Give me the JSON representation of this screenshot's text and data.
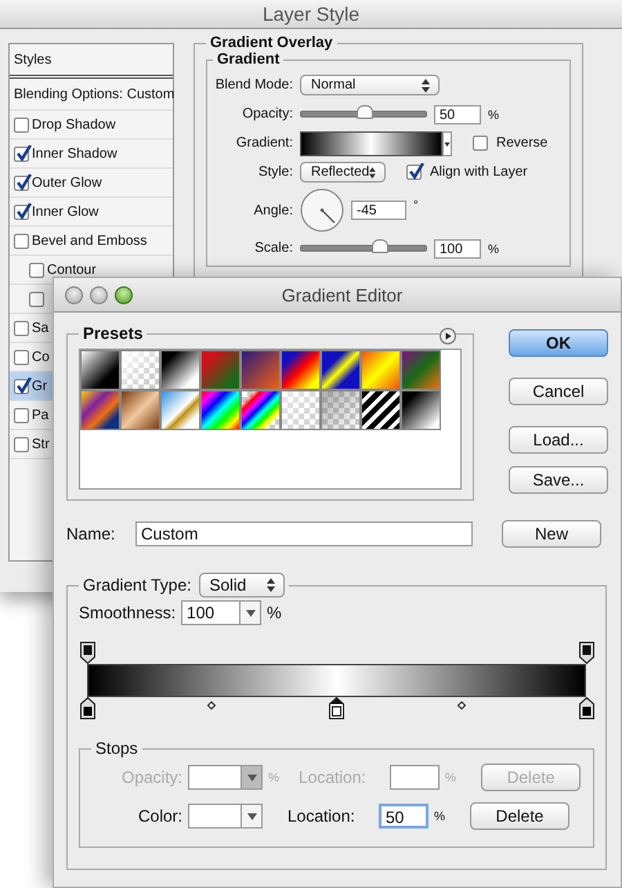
{
  "layer_style": {
    "title": "Layer Style",
    "styles_list": [
      {
        "label": "Styles",
        "kind": "header",
        "selected": false
      },
      {
        "label": "Blending Options: Custom",
        "kind": "header",
        "selected": false
      },
      {
        "label": "Drop Shadow",
        "kind": "check",
        "checked": false,
        "selected": false
      },
      {
        "label": "Inner Shadow",
        "kind": "check",
        "checked": true,
        "selected": false
      },
      {
        "label": "Outer Glow",
        "kind": "check",
        "checked": true,
        "selected": false
      },
      {
        "label": "Inner Glow",
        "kind": "check",
        "checked": true,
        "selected": false
      },
      {
        "label": "Bevel and Emboss",
        "kind": "check",
        "checked": false,
        "selected": false
      },
      {
        "label": "Contour",
        "kind": "subcheck",
        "checked": false,
        "selected": false
      },
      {
        "kind": "subcheck",
        "checked": false,
        "selected": false
      },
      {
        "label": "Sa",
        "kind": "check",
        "checked": false,
        "selected": false
      },
      {
        "label": "Co",
        "kind": "check",
        "checked": false,
        "selected": false
      },
      {
        "label": "Gr",
        "kind": "check",
        "checked": true,
        "selected": true
      },
      {
        "label": "Pa",
        "kind": "check",
        "checked": false,
        "selected": false
      },
      {
        "label": "Str",
        "kind": "check",
        "checked": false,
        "selected": false
      }
    ],
    "gradient_overlay": {
      "title": "Gradient Overlay",
      "group_title": "Gradient",
      "blend_mode": {
        "label": "Blend Mode:",
        "value": "Normal"
      },
      "opacity": {
        "label": "Opacity:",
        "level": 0.5,
        "value": "50",
        "unit": "%"
      },
      "gradient": {
        "label": "Gradient:"
      },
      "reverse": {
        "label": "Reverse",
        "checked": false
      },
      "style": {
        "label": "Style:",
        "value": "Reflected"
      },
      "align_with_layer": {
        "label": "Align with Layer",
        "checked": true
      },
      "angle": {
        "label": "Angle:",
        "value": "-45",
        "unit": "°"
      },
      "scale": {
        "label": "Scale:",
        "level": 0.62,
        "value": "100",
        "unit": "%"
      }
    }
  },
  "gradient_editor": {
    "title": "Gradient Editor",
    "presets_title": "Presets",
    "buttons": [
      {
        "label": "OK",
        "kind": "default"
      },
      {
        "label": "Cancel",
        "kind": "normal"
      },
      {
        "label": "Load...",
        "kind": "normal"
      },
      {
        "label": "Save...",
        "kind": "normal"
      }
    ],
    "name": {
      "label": "Name:",
      "value": "Custom"
    },
    "new_button": "New",
    "gradient_type": {
      "label": "Gradient Type:",
      "value": "Solid"
    },
    "smoothness": {
      "label": "Smoothness:",
      "value": "100",
      "unit": "%"
    },
    "opacity_stops": [
      {
        "level": 0,
        "selected": false
      },
      {
        "level": 1,
        "selected": false
      }
    ],
    "color_stops": [
      {
        "level": 0,
        "color": "#000000",
        "selected": false
      },
      {
        "level": 0.5,
        "color": "#ffffff",
        "selected": true
      },
      {
        "level": 1,
        "color": "#000000",
        "selected": false
      }
    ],
    "stops": {
      "title": "Stops",
      "opacity_row": {
        "disabled": true,
        "label": "Opacity:",
        "unit": "%",
        "location_label": "Location:",
        "location_unit": "%",
        "delete": "Delete"
      },
      "color_row": {
        "disabled": false,
        "label": "Color:",
        "location_label": "Location:",
        "location_value": "50",
        "location_unit": "%",
        "delete": "Delete"
      }
    }
  }
}
